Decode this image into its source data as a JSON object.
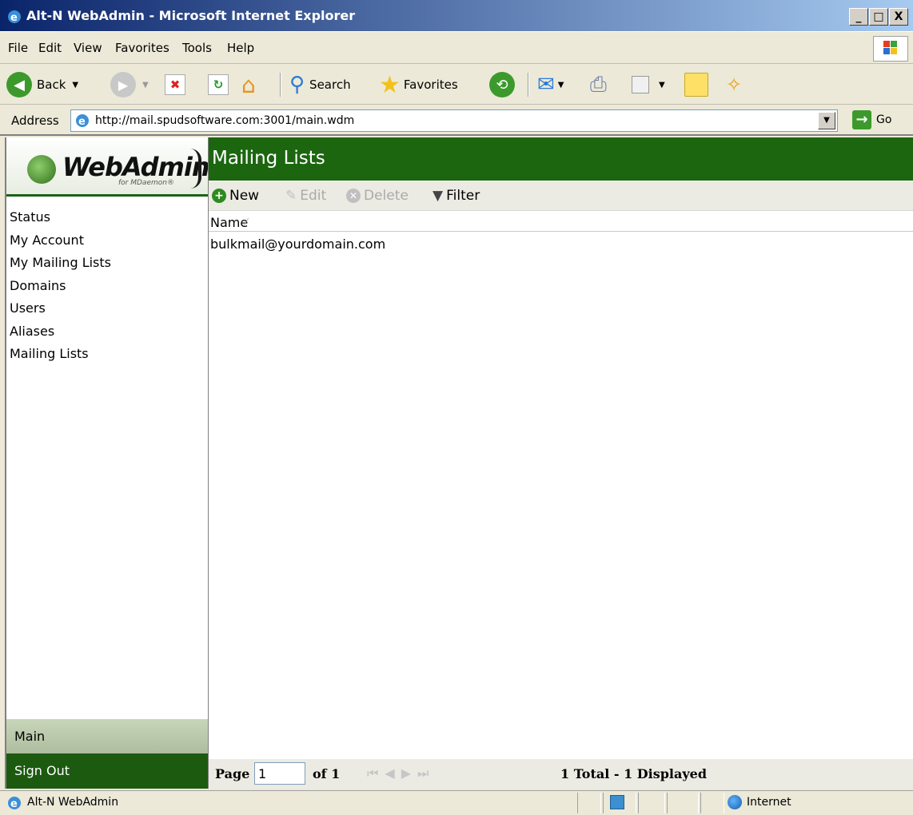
{
  "window": {
    "title": "Alt-N WebAdmin - Microsoft Internet Explorer",
    "min_glyph": "_",
    "max_glyph": "□",
    "close_glyph": "X"
  },
  "menu": [
    "File",
    "Edit",
    "View",
    "Favorites",
    "Tools",
    "Help"
  ],
  "toolbar": {
    "back_label": "Back",
    "search_label": "Search",
    "favorites_label": "Favorites"
  },
  "address": {
    "label": "Address",
    "url": "http://mail.spudsoftware.com:3001/main.wdm",
    "go_label": "Go"
  },
  "sidebar": {
    "logo_text": "WebAdmin",
    "logo_sub": "for MDaemon®",
    "items": [
      "Status",
      "My Account",
      "My Mailing Lists",
      "Domains",
      "Users",
      "Aliases",
      "Mailing Lists"
    ],
    "main_label": "Main",
    "signout_label": "Sign Out"
  },
  "main": {
    "title": "Mailing Lists",
    "actions": {
      "new_label": "New",
      "edit_label": "Edit",
      "delete_label": "Delete",
      "filter_label": "Filter"
    },
    "column_header": "Name",
    "sort_glyph": "⁄",
    "rows": [
      "bulkmail@yourdomain.com"
    ],
    "pager": {
      "page_label": "Page",
      "page_value": "1",
      "of_label": "of 1",
      "summary": "1 Total - 1 Displayed"
    }
  },
  "status": {
    "text": "Alt-N WebAdmin",
    "zone": "Internet"
  },
  "colors": {
    "header_green": "#1c6610",
    "signout_green": "#1c5a10",
    "toolbar_bg": "#ece9d8"
  }
}
